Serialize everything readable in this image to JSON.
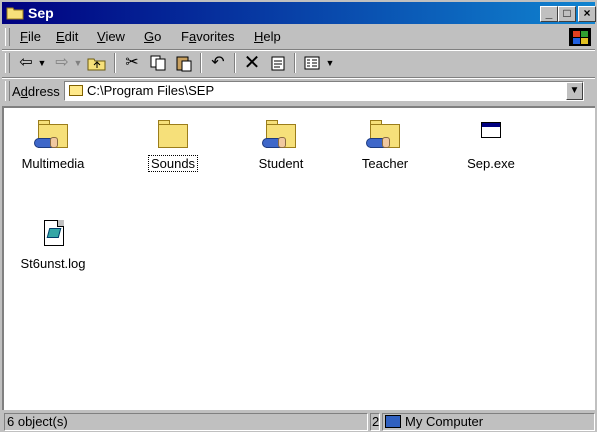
{
  "window": {
    "title": "Sep",
    "title_icon": "folder-icon"
  },
  "menubar": {
    "items": [
      {
        "label": "File",
        "mnemonic": "F",
        "rest": "ile"
      },
      {
        "label": "Edit",
        "mnemonic": "E",
        "rest": "dit"
      },
      {
        "label": "View",
        "mnemonic": "V",
        "rest": "iew"
      },
      {
        "label": "Go",
        "mnemonic": "G",
        "rest": "o"
      },
      {
        "label": "Favorites",
        "prefix": "F",
        "mnemonic": "a",
        "rest": "vorites"
      },
      {
        "label": "Help",
        "mnemonic": "H",
        "rest": "elp"
      }
    ]
  },
  "toolbar": {
    "buttons": [
      "back-icon",
      "forward-icon",
      "up-folder-icon",
      "cut-icon",
      "copy-icon",
      "paste-icon",
      "undo-icon",
      "delete-icon",
      "properties-icon",
      "views-icon"
    ]
  },
  "address": {
    "label": "Address",
    "mnemonic": "d",
    "value": "C:\\Program Files\\SEP"
  },
  "files": [
    {
      "name": "Multimedia",
      "kind": "shared-folder",
      "selected": false
    },
    {
      "name": "Sounds",
      "kind": "folder",
      "selected": true
    },
    {
      "name": "Student",
      "kind": "shared-folder",
      "selected": false
    },
    {
      "name": "Teacher",
      "kind": "shared-folder",
      "selected": false
    },
    {
      "name": "Sep.exe",
      "kind": "application",
      "selected": false
    },
    {
      "name": "St6unst.log",
      "kind": "log-document",
      "selected": false
    }
  ],
  "status": {
    "objects": "6 object(s)",
    "middle": "2",
    "zone": "My Computer"
  },
  "colors": {
    "titlebar_start": "#000080",
    "titlebar_end": "#1084d0",
    "face": "#c0c0c0"
  }
}
